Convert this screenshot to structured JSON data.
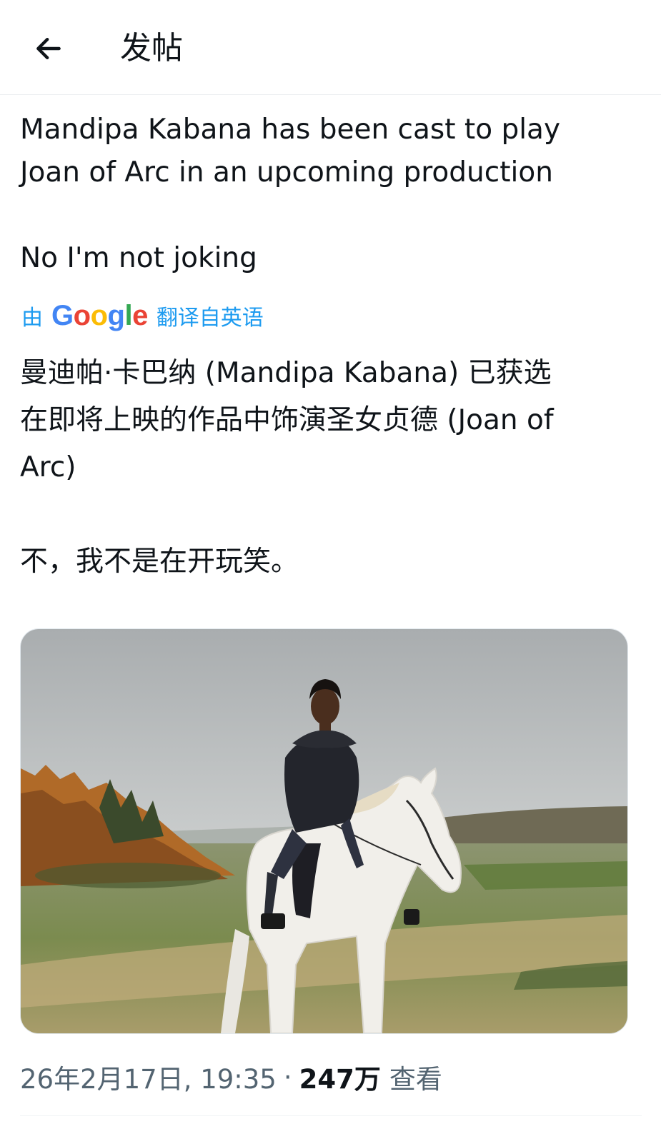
{
  "header": {
    "title": "发帖",
    "back_icon": "arrow-left-icon"
  },
  "post": {
    "original_lines": [
      "Mandipa Kabana has been cast to play",
      "Joan of Arc in an upcoming production"
    ],
    "original_joke": "No I'm not joking",
    "translate": {
      "prefix": "由",
      "brand": "Google",
      "suffix": "翻译自英语"
    },
    "translated_lines": [
      "曼迪帕·卡巴纳 (Mandipa Kabana) 已获选",
      "在即将上映的作品中饰演圣女贞德 (Joan of",
      "Arc)"
    ],
    "translated_joke": "不，我不是在开玩笑。"
  },
  "meta": {
    "timestamp": "26年2月17日, 19:35",
    "separator": "·",
    "views_count": "247万",
    "views_label": "查看"
  }
}
